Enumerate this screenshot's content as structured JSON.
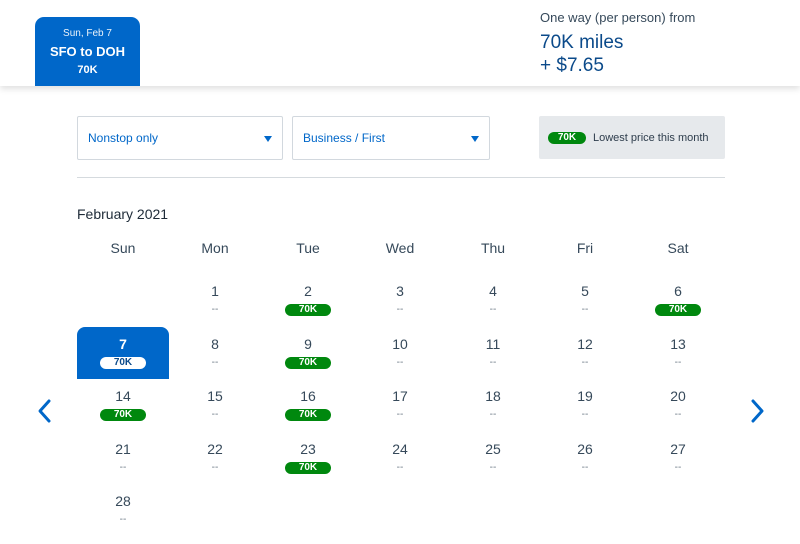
{
  "header": {
    "date_tab": {
      "date": "Sun, Feb 7",
      "route": "SFO to DOH",
      "price": "70K"
    },
    "fare": {
      "label": "One way (per person) from",
      "miles": "70K miles",
      "taxes": "+ $7.65"
    }
  },
  "filters": {
    "stops": {
      "value": "Nonstop only"
    },
    "cabin": {
      "value": "Business / First"
    },
    "legend": {
      "badge": "70K",
      "text": "Lowest price this month"
    }
  },
  "calendar": {
    "month": "February 2021",
    "weekdays": [
      "Sun",
      "Mon",
      "Tue",
      "Wed",
      "Thu",
      "Fri",
      "Sat"
    ],
    "days": [
      {
        "day": "1",
        "price": "--",
        "available": false,
        "selected": false
      },
      {
        "day": "2",
        "price": "70K",
        "available": true,
        "selected": false
      },
      {
        "day": "3",
        "price": "--",
        "available": false,
        "selected": false
      },
      {
        "day": "4",
        "price": "--",
        "available": false,
        "selected": false
      },
      {
        "day": "5",
        "price": "--",
        "available": false,
        "selected": false
      },
      {
        "day": "6",
        "price": "70K",
        "available": true,
        "selected": false
      },
      {
        "day": "7",
        "price": "70K",
        "available": true,
        "selected": true
      },
      {
        "day": "8",
        "price": "--",
        "available": false,
        "selected": false
      },
      {
        "day": "9",
        "price": "70K",
        "available": true,
        "selected": false
      },
      {
        "day": "10",
        "price": "--",
        "available": false,
        "selected": false
      },
      {
        "day": "11",
        "price": "--",
        "available": false,
        "selected": false
      },
      {
        "day": "12",
        "price": "--",
        "available": false,
        "selected": false
      },
      {
        "day": "13",
        "price": "--",
        "available": false,
        "selected": false
      },
      {
        "day": "14",
        "price": "70K",
        "available": true,
        "selected": false
      },
      {
        "day": "15",
        "price": "--",
        "available": false,
        "selected": false
      },
      {
        "day": "16",
        "price": "70K",
        "available": true,
        "selected": false
      },
      {
        "day": "17",
        "price": "--",
        "available": false,
        "selected": false
      },
      {
        "day": "18",
        "price": "--",
        "available": false,
        "selected": false
      },
      {
        "day": "19",
        "price": "--",
        "available": false,
        "selected": false
      },
      {
        "day": "20",
        "price": "--",
        "available": false,
        "selected": false
      },
      {
        "day": "21",
        "price": "--",
        "available": false,
        "selected": false
      },
      {
        "day": "22",
        "price": "--",
        "available": false,
        "selected": false
      },
      {
        "day": "23",
        "price": "70K",
        "available": true,
        "selected": false
      },
      {
        "day": "24",
        "price": "--",
        "available": false,
        "selected": false
      },
      {
        "day": "25",
        "price": "--",
        "available": false,
        "selected": false
      },
      {
        "day": "26",
        "price": "--",
        "available": false,
        "selected": false
      },
      {
        "day": "27",
        "price": "--",
        "available": false,
        "selected": false
      },
      {
        "day": "28",
        "price": "--",
        "available": false,
        "selected": false
      }
    ]
  },
  "navigation": {
    "prev_icon": "chevron-left-icon",
    "next_icon": "chevron-right-icon"
  },
  "colors": {
    "brand_blue": "#0067c9",
    "price_green": "#00880e",
    "text_navy": "#0b4a8a"
  }
}
